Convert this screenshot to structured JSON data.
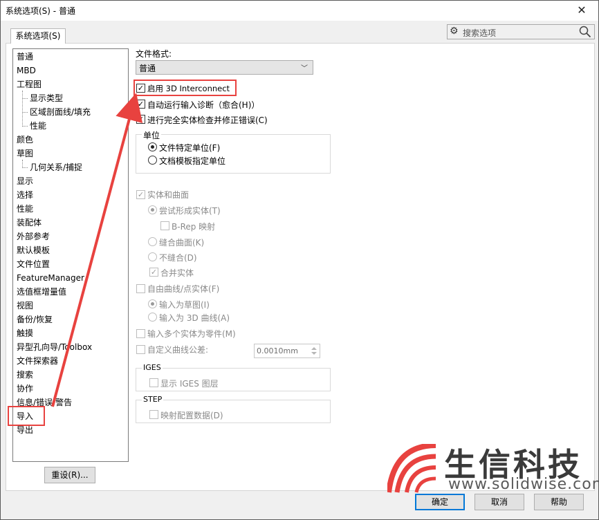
{
  "window": {
    "title": "系统选项(S) - 普通",
    "close": "✕"
  },
  "tab": {
    "label": "系统选项(S)"
  },
  "search": {
    "placeholder": "搜索选项"
  },
  "tree": {
    "items": [
      "普通",
      "MBD",
      "工程图",
      "显示类型",
      "区域剖面线/填充",
      "性能",
      "颜色",
      "草图",
      "几何关系/捕捉",
      "显示",
      "选择",
      "性能",
      "装配体",
      "外部参考",
      "默认模板",
      "文件位置",
      "FeatureManager",
      "选值框增量值",
      "视图",
      "备份/恢复",
      "触摸",
      "异型孔向导/Toolbox",
      "文件探索器",
      "搜索",
      "协作",
      "信息/错误/警告",
      "导入",
      "导出"
    ]
  },
  "reset_button": "重设(R)...",
  "file_format": {
    "label": "文件格式:",
    "value": "普通"
  },
  "options": {
    "enable_3d_interconnect": "启用 3D Interconnect",
    "auto_diagnose": "自动运行输入诊断（愈合(H)）",
    "full_check": "进行完全实体检查并修正错误(C)",
    "units_title": "单位",
    "unit_file": "文件特定单位(F)",
    "unit_template": "文档模板指定单位",
    "solid_surface": "实体和曲面",
    "try_solid": "尝试形成实体(T)",
    "brep": "B-Rep 映射",
    "knit": "缝合曲面(K)",
    "no_knit": "不缝合(D)",
    "merge": "合并实体",
    "free_curves": "自由曲线/点实体(F)",
    "as_sketch": "输入为草图(I)",
    "as_3d_curve": "输入为 3D 曲线(A)",
    "multi_parts": "输入多个实体为零件(M)",
    "custom_tol": "自定义曲线公差:",
    "tol_value": "0.0010mm",
    "iges_title": "IGES",
    "iges_layers": "显示 IGES 图层",
    "step_title": "STEP",
    "step_map": "映射配置数据(D)"
  },
  "buttons": {
    "ok": "确定",
    "cancel": "取消",
    "help": "帮助"
  },
  "watermark": {
    "brand_cn": "生信科技",
    "url": "www.solidwise.com"
  },
  "colors": {
    "accent_red": "#e8423f",
    "focus_blue": "#0078d7"
  }
}
